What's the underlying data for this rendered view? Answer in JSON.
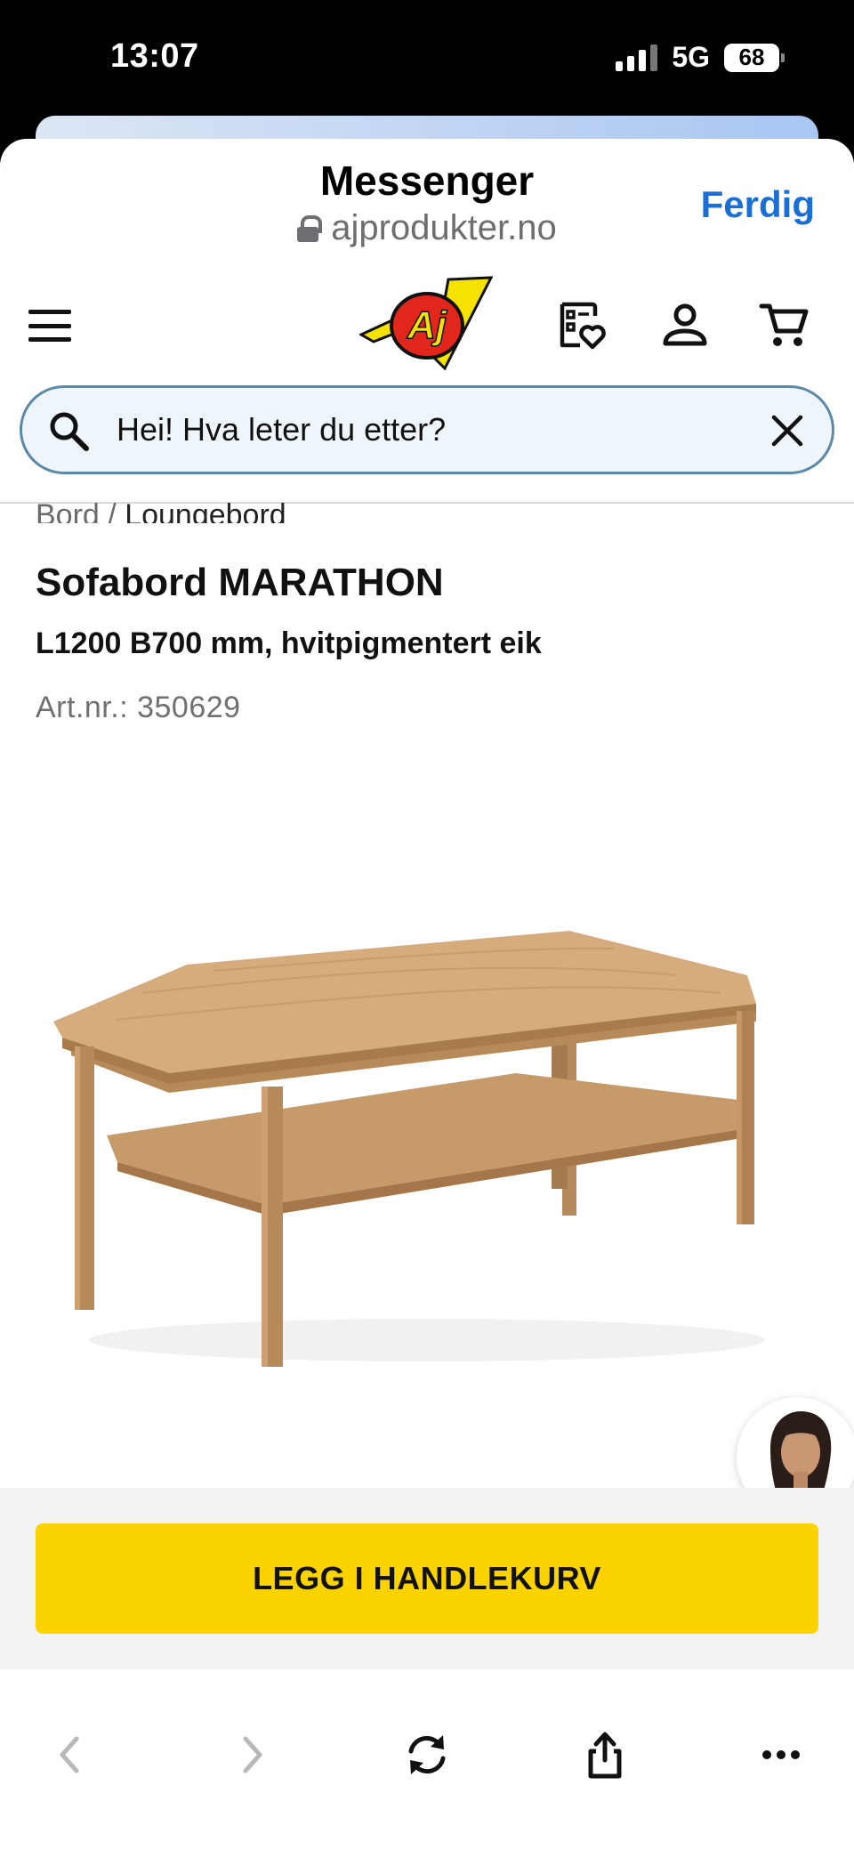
{
  "status_bar": {
    "time": "13:07",
    "network": "5G",
    "battery": "68"
  },
  "browser": {
    "title": "Messenger",
    "url": "ajprodukter.no",
    "done_label": "Ferdig"
  },
  "header": {
    "logo_text": "AJ"
  },
  "search": {
    "placeholder": "Hei! Hva leter du etter?"
  },
  "breadcrumb": {
    "parent": "Bord",
    "separator": "/",
    "current": "Loungebord"
  },
  "product": {
    "title": "Sofabord MARATHON",
    "subtitle": "L1200 B700 mm, hvitpigmentert eik",
    "article_number": "Art.nr.: 350629"
  },
  "cta": {
    "add_to_cart_label": "LEGG I HANDLEKURV"
  },
  "colors": {
    "accent_yellow": "#fbd400",
    "link_blue": "#1a6fd6",
    "search_border": "#5a8aa8"
  },
  "icons": {
    "header": [
      "menu-icon",
      "wishlist-icon",
      "user-icon",
      "cart-icon"
    ],
    "bottom_bar": [
      "back-icon",
      "forward-icon",
      "reload-icon",
      "share-icon",
      "more-icon"
    ]
  }
}
